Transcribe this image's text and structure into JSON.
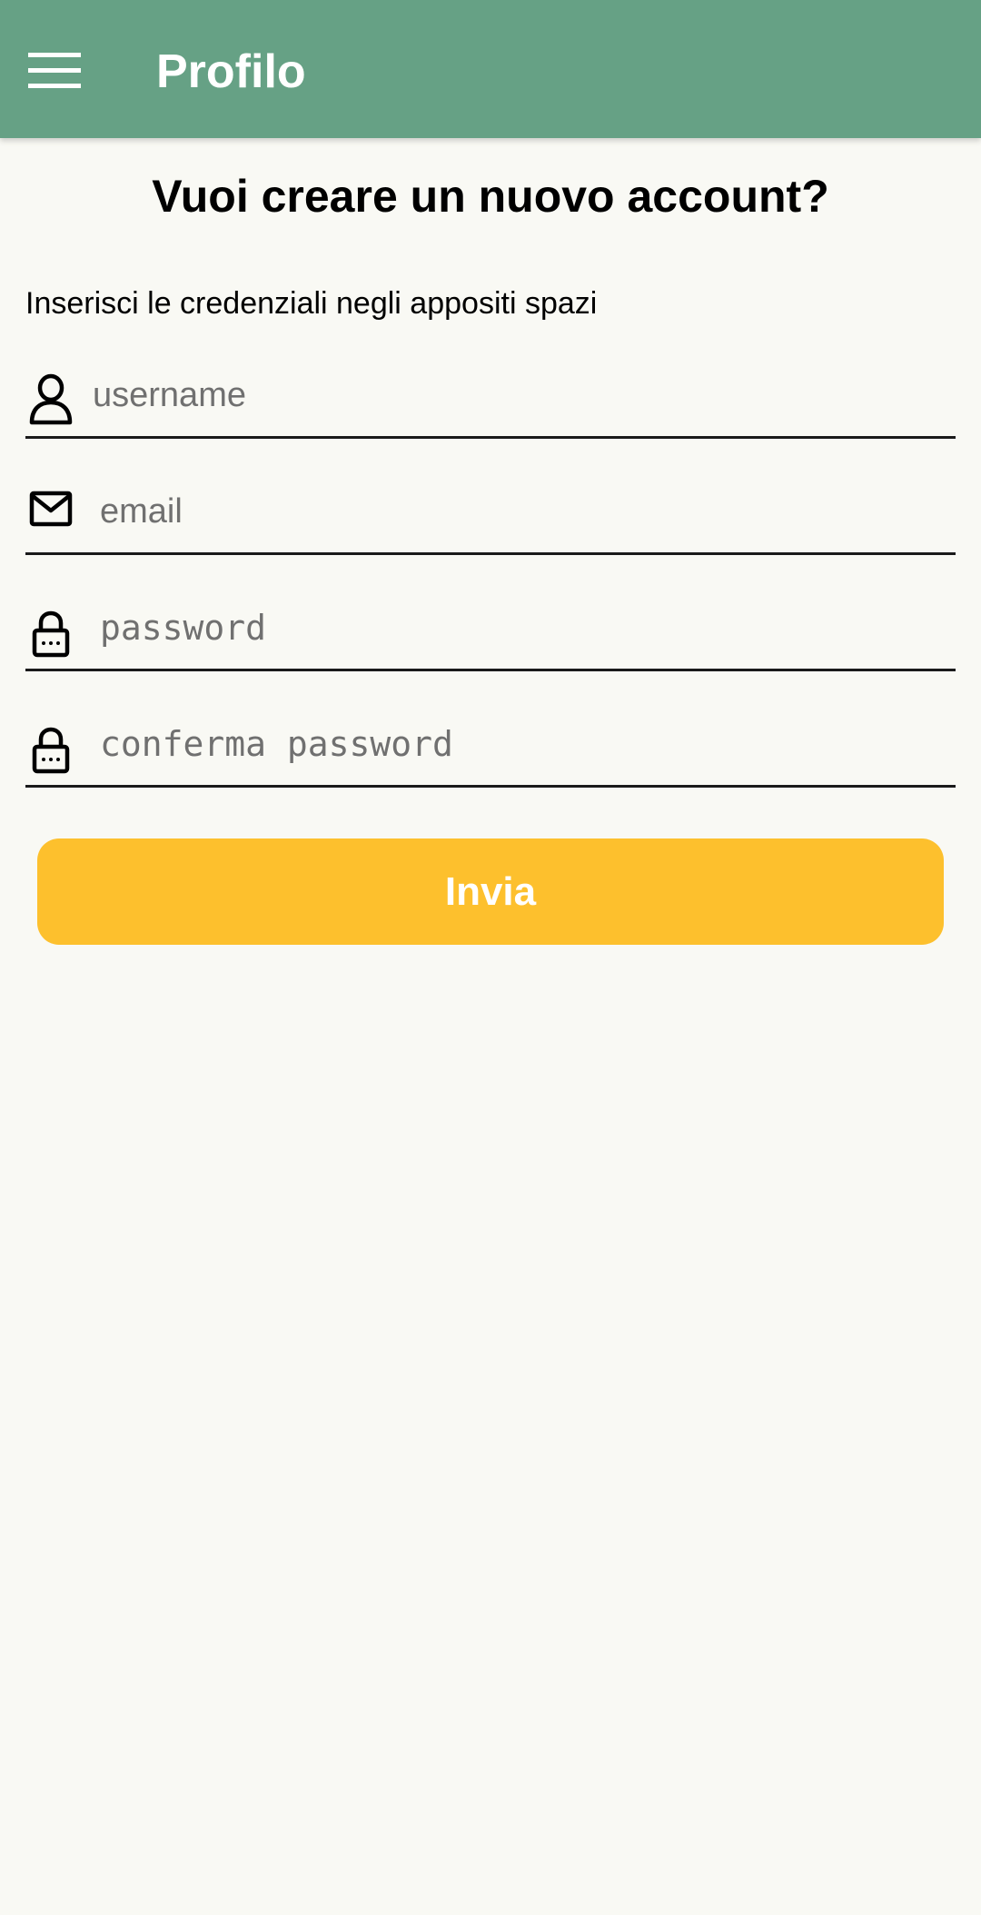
{
  "appbar": {
    "title": "Profilo",
    "menu_icon": "hamburger-menu-icon",
    "background": "#66A185",
    "title_color": "#FFFFFF"
  },
  "page": {
    "heading": "Vuoi creare un nuovo account?",
    "subtitle": "Inserisci le credenziali negli appositi spazi",
    "background": "#F9F9F4"
  },
  "form": {
    "username": {
      "placeholder": "username",
      "value": "",
      "icon": "person-icon"
    },
    "email": {
      "placeholder": "email",
      "value": "",
      "icon": "mail-icon"
    },
    "password": {
      "placeholder": "password",
      "value": "",
      "icon": "lock-icon"
    },
    "confirm_password": {
      "placeholder": "conferma password",
      "value": "",
      "icon": "lock-icon"
    }
  },
  "submit": {
    "label": "Invia",
    "color": "#FDC02D",
    "text_color": "#FFFFFF"
  }
}
